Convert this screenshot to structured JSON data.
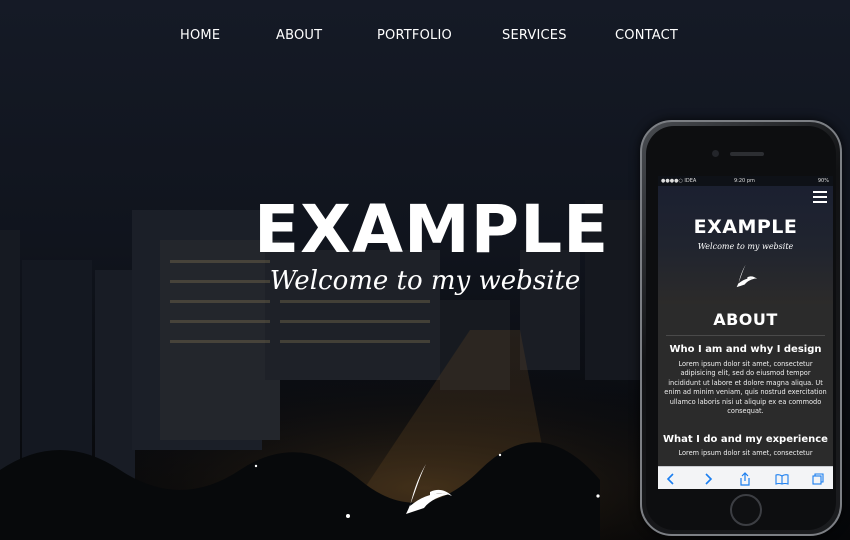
{
  "nav": {
    "items": [
      "HOME",
      "ABOUT",
      "PORTFOLIO",
      "SERVICES",
      "CONTACT"
    ]
  },
  "hero": {
    "title": "EXAMPLE",
    "subtitle": "Welcome to my website",
    "logo_icon": "swift-bird-logo-icon"
  },
  "phone": {
    "status": {
      "carrier": "●●●●○ IDEA",
      "time": "9:20 pm",
      "battery": "90%"
    },
    "title": "EXAMPLE",
    "subtitle": "Welcome to my website",
    "about": {
      "heading": "ABOUT",
      "section1_title": "Who I am and why I design",
      "section1_text": "Lorem ipsum dolor sit amet, consectetur adipisicing elit, sed do eiusmod tempor incididunt ut labore et dolore magna aliqua. Ut enim ad minim veniam, quis nostrud exercitation ullamco laboris nisi ut aliquip ex ea commodo consequat.",
      "section2_title": "What I do and my experience",
      "section2_text": "Lorem ipsum dolor sit amet, consectetur"
    },
    "toolbar_icons": [
      "back-icon",
      "forward-icon",
      "share-icon",
      "bookmarks-icon",
      "tabs-icon"
    ]
  },
  "colors": {
    "background": "#0b0e15",
    "text": "#ffffff",
    "toolbar_accent": "#1a7ef0"
  }
}
